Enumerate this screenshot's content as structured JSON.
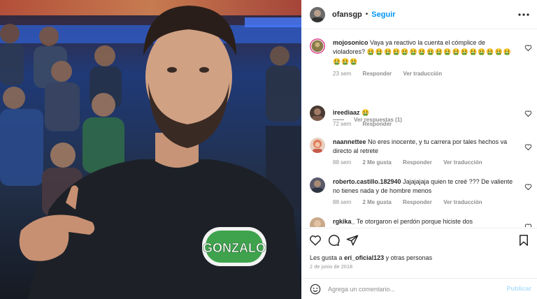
{
  "post": {
    "photo_alt": "",
    "badge_text": "GONZALO"
  },
  "header": {
    "username": "ofansgp",
    "separator": "•",
    "follow_label": "Seguir"
  },
  "comments": [
    {
      "username": "mojosonico",
      "text": "Vaya ya reactivo la cuenta el cómplice de violadores?",
      "emojis": "🤮🤮🤮🤮🤮🤮🤮🤮🤮🤮🤮🤮🤮🤮🤮🤮🤮🤮🤮🤮",
      "time": "23 sem",
      "likes": "",
      "reply_label": "Responder",
      "translate_label": "Ver traducción"
    },
    {
      "username": "ireediaaz",
      "text": "",
      "emojis": "🤮",
      "time": "72 sem",
      "likes": "",
      "reply_label": "Responder",
      "translate_label": ""
    },
    {
      "username": "naannettee",
      "text": "No eres inocente, y tu carrera por tales hechos va directo al retrete",
      "emojis": "",
      "time": "88 sem",
      "likes": "2 Me gusta",
      "reply_label": "Responder",
      "translate_label": "Ver traducción"
    },
    {
      "username": "roberto.castillo.182940",
      "text": "Jajajajaja quien te creé ??? De valiente no tienes nada y de hombre menos",
      "emojis": "",
      "time": "88 sem",
      "likes": "2 Me gusta",
      "reply_label": "Responder",
      "translate_label": "Ver traducción"
    },
    {
      "username": "rgkika_",
      "text": "Te otorgaron el perdón porque hiciste dos",
      "emojis": "",
      "time": "",
      "likes": "",
      "reply_label": "",
      "translate_label": ""
    }
  ],
  "view_replies_label": "Ver respuestas (1)",
  "actions": {
    "liked_by_prefix": "Les gusta a",
    "liked_by_user": "eri_oficial123",
    "liked_by_suffix": "y otras personas",
    "date": "2 de junio de 2018"
  },
  "add_comment": {
    "placeholder": "Agrega un comentario...",
    "publish_label": "Publicar"
  },
  "icons": {
    "like": "heart-icon",
    "comment": "comment-icon",
    "share": "send-icon",
    "save": "bookmark-icon",
    "more": "more-options-icon",
    "emoji": "emoji-icon"
  },
  "colors": {
    "accent": "#0095f6",
    "publish_disabled": "#b2dffc",
    "muted": "#8e8e8e",
    "badge_green": "#3fa34d"
  }
}
